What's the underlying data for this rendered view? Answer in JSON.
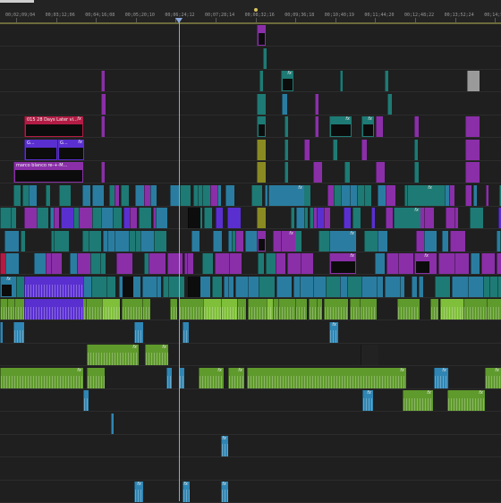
{
  "ruler": {
    "timecodes": [
      "00;02;09;04",
      "00;03;12;06",
      "00;04;16;08",
      "00;05;20;10",
      "00;06;24;12",
      "00;07;28;14",
      "00;08;32;16",
      "00;09;36;18",
      "00;10;40;19",
      "00;11;44;20",
      "00;12;48;22",
      "00;13;52;24",
      "00;14;56"
    ]
  },
  "clips": {
    "title_a": "015 28 Days Later vi...",
    "title_b_1": "G...",
    "title_b_2": "G...",
    "title_c": "marco blanco re-+-M...",
    "fx": "fx"
  },
  "colors": {
    "teal": "#1e7a74",
    "blue": "#2a7da0",
    "magenta": "#8a2fa8",
    "crimson": "#b21c44",
    "violet": "#5a2fd0",
    "audio_green": "#5f9a2c",
    "audio_blue": "#2f86b4",
    "olive": "#8a8a22",
    "playhead": "#8aa7dd"
  }
}
